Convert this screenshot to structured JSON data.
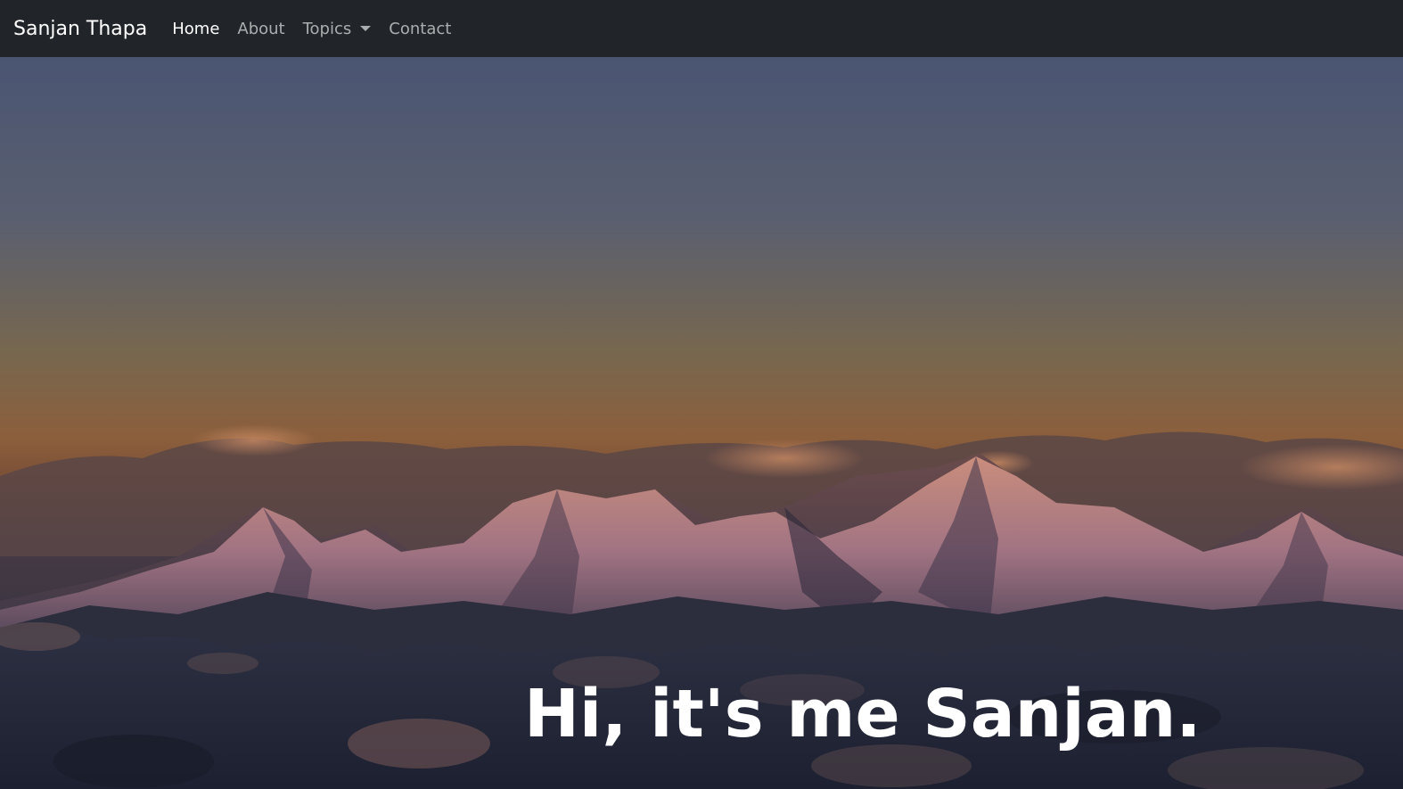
{
  "navbar": {
    "brand": "Sanjan Thapa",
    "links": [
      {
        "label": "Home",
        "active": true
      },
      {
        "label": "About",
        "active": false
      },
      {
        "label": "Topics",
        "active": false,
        "dropdown": true
      },
      {
        "label": "Contact",
        "active": false
      }
    ],
    "background_color": "#212529"
  },
  "hero": {
    "background_image": "mountain-range-above-clouds-at-sunset",
    "title": "Hi, it's me Sanjan."
  }
}
